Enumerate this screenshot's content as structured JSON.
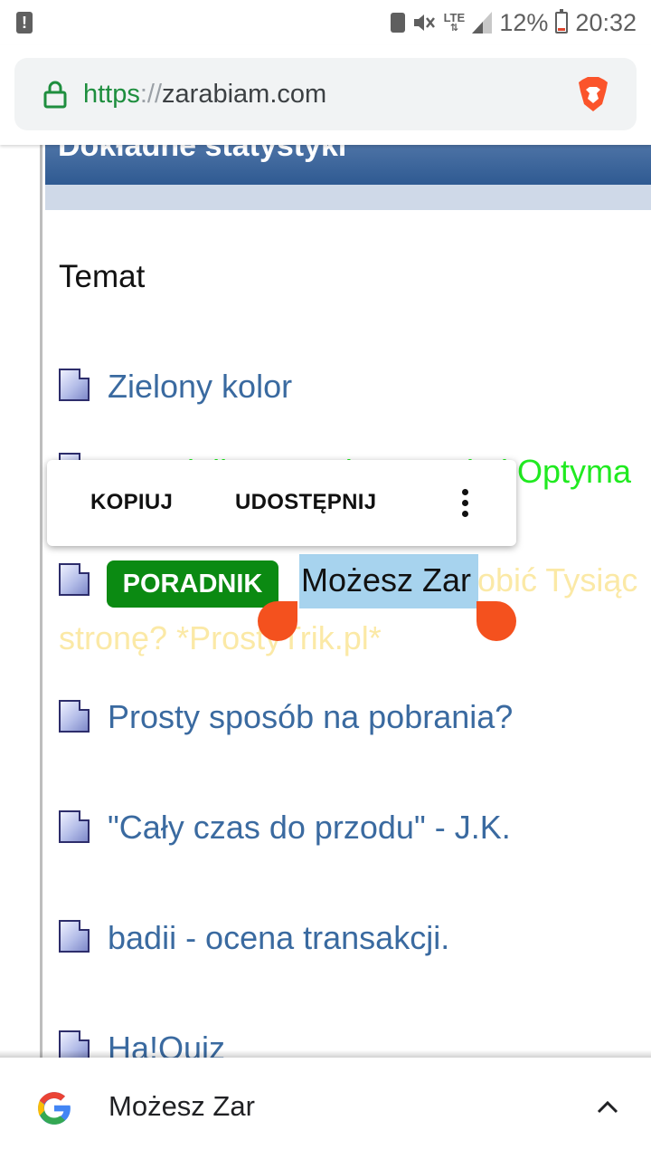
{
  "status_bar": {
    "battery_percent": "12%",
    "time": "20:32",
    "network": "LTE",
    "icons": [
      "alert-icon",
      "save-icon",
      "mute-icon",
      "signal-icon",
      "battery-icon"
    ]
  },
  "browser": {
    "url_scheme": "https",
    "url_separator": "://",
    "url_host": "zarabiam.com",
    "icons": [
      "lock-icon",
      "brave-icon"
    ]
  },
  "forum": {
    "header_title": "Dokładne statystyki",
    "column_header": "Temat",
    "topics": [
      {
        "title": "Zielony kolor",
        "color": "#3a6aa0"
      },
      {
        "title": "Poradnik \"Pozycjonowanie i Optyma",
        "color": "#20ea20"
      },
      {
        "badge": "PORADNIK",
        "selected": "Możesz Zar",
        "rest": "obić Tysiąc",
        "rest_line2": "stronę? *ProstyTrik.pl*",
        "color": "#fbe9a6"
      },
      {
        "title": "Prosty sposób na pobrania?",
        "color": "#3a6aa0"
      },
      {
        "title": "\"Cały czas do przodu\" - J.K.",
        "color": "#3a6aa0"
      },
      {
        "title": "badii - ocena transakcji.",
        "color": "#3a6aa0"
      },
      {
        "title": "Ha!Quiz",
        "color": "#3a6aa0"
      }
    ]
  },
  "selection_menu": {
    "copy_label": "KOPIUJ",
    "share_label": "UDOSTĘPNIJ",
    "more_icon": "more-vert-icon"
  },
  "search_sheet": {
    "query": "Możesz Zar",
    "icons": [
      "google-icon",
      "chevron-up-icon"
    ]
  },
  "colors": {
    "accent_selection": "#a7d3ee",
    "handle": "#f4511e",
    "badge": "#0b8a12",
    "header": "#2f5a92"
  }
}
